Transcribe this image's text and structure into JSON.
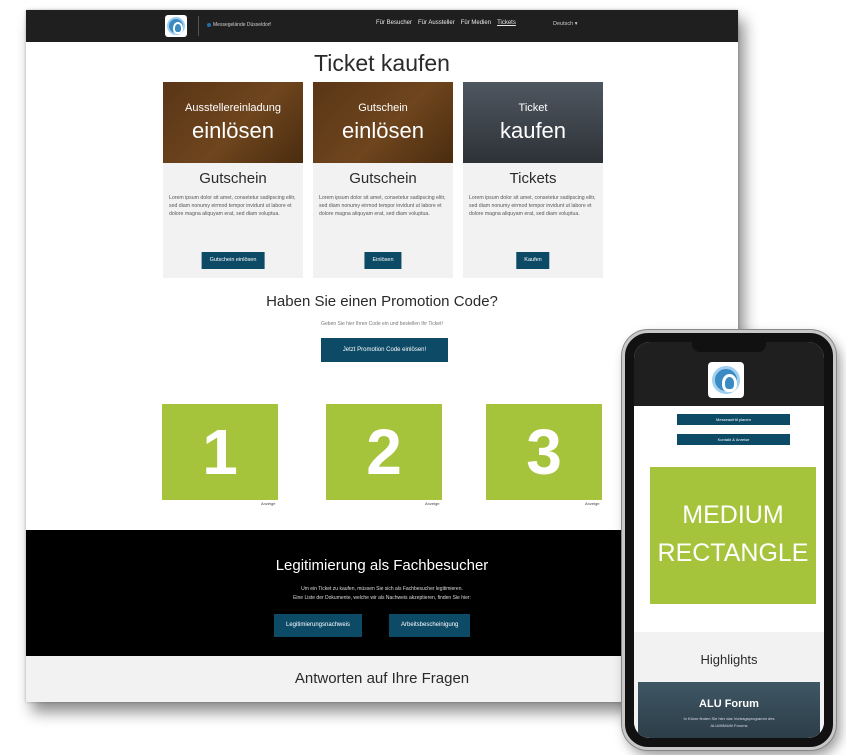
{
  "desktop": {
    "header": {
      "venue": "Messegelände Düsseldorf",
      "nav": [
        "Für Besucher",
        "Für Aussteller",
        "Für Medien",
        "Tickets"
      ],
      "language": "Deutsch ▾"
    },
    "page_title": "Ticket kaufen",
    "cards": [
      {
        "image_sub": "Ausstellereinladung",
        "image_big": "einlösen",
        "title": "Gutschein",
        "text": "Lorem ipsum dolor sit amet, consetetur sadipscing elitr, sed diam nonumy eirmod tempor invidunt ut labore et dolore magna aliquyam erat, sed diam voluptua.",
        "button": "Gutschein einlösen"
      },
      {
        "image_sub": "Gutschein",
        "image_big": "einlösen",
        "title": "Gutschein",
        "text": "Lorem ipsum dolor sit amet, consetetur sadipscing elitr, sed diam nonumy eirmod tempor invidunt ut labore et dolore magna aliquyam erat, sed diam voluptua.",
        "button": "Einlösen"
      },
      {
        "image_sub": "Ticket",
        "image_big": "kaufen",
        "title": "Tickets",
        "text": "Lorem ipsum dolor sit amet, consetetur sadipscing elitr, sed diam nonumy eirmod tempor invidunt ut labore et dolore magna aliquyam erat, sed diam voluptua.",
        "button": "Kaufen"
      }
    ],
    "promo": {
      "title": "Haben Sie einen Promotion Code?",
      "subtitle": "Geben Sie hier Ihren Code ein und bestellen Ihr Ticket!",
      "button": "Jetzt Promotion Code einlösen!"
    },
    "ads": [
      {
        "number": "1",
        "label": "Anzeige"
      },
      {
        "number": "2",
        "label": "Anzeige"
      },
      {
        "number": "3",
        "label": "Anzeige"
      }
    ],
    "legitimation": {
      "title": "Legitimierung als Fachbesucher",
      "line1": "Um ein Ticket zu kaufen, müssen Sie sich als Fachbesucher legitimieren.",
      "line2": "Eine Liste der Dokumente, welche wir als Nachweis akzeptieren, finden Sie hier:",
      "button1": "Legitimierungsnachweis",
      "button2": "Arbeitsbescheinigung"
    },
    "faq_title": "Antworten auf Ihre Fragen"
  },
  "mobile": {
    "buttons": [
      "Messeaufritt planen",
      "Kontakt & Anreise"
    ],
    "ad_line1": "MEDIUM",
    "ad_line2": "RECTANGLE",
    "highlights": "Highlights",
    "forum_title": "ALU Forum",
    "forum_line1": "In Kürze finden Sie hier das Vortragsprogramm des",
    "forum_line2": "ALUMINIUM Forums"
  },
  "colors": {
    "accent_button": "#0d4a66",
    "ad_green": "#a6c43b",
    "header_dark": "#1f1f1f"
  },
  "icons": [
    "logo-icon"
  ]
}
